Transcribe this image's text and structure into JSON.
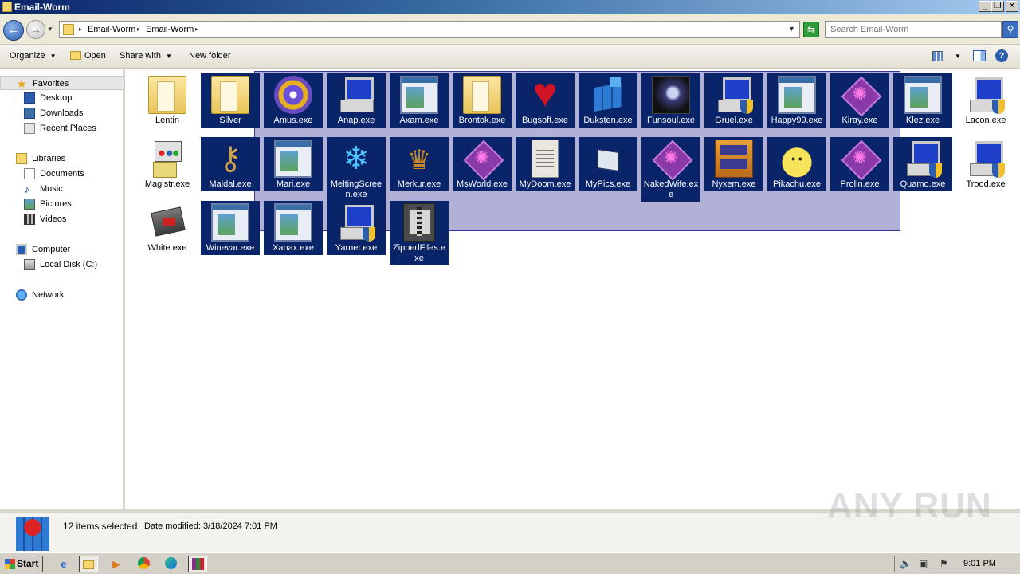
{
  "window": {
    "title": "Email-Worm"
  },
  "address": {
    "crumbs": [
      "Email-Worm",
      "Email-Worm"
    ],
    "search_placeholder": "Search Email-Worm"
  },
  "toolbar": {
    "organize": "Organize",
    "open": "Open",
    "share_with": "Share with",
    "new_folder": "New folder"
  },
  "sidebar": {
    "favorites": {
      "label": "Favorites",
      "items": [
        "Desktop",
        "Downloads",
        "Recent Places"
      ]
    },
    "libraries": {
      "label": "Libraries",
      "items": [
        "Documents",
        "Music",
        "Pictures",
        "Videos"
      ]
    },
    "computer": {
      "label": "Computer",
      "items": [
        "Local Disk (C:)"
      ]
    },
    "network": {
      "label": "Network"
    }
  },
  "files": [
    {
      "name": "Lentin",
      "selected": false,
      "icon": "folder-icon"
    },
    {
      "name": "Silver",
      "selected": true,
      "icon": "folder-icon"
    },
    {
      "name": "Amus.exe",
      "selected": true,
      "icon": "disc-icon"
    },
    {
      "name": "Anap.exe",
      "selected": true,
      "icon": "computer-icon"
    },
    {
      "name": "Axam.exe",
      "selected": true,
      "icon": "window-icon"
    },
    {
      "name": "Brontok.exe",
      "selected": true,
      "icon": "folder-icon"
    },
    {
      "name": "Bugsoft.exe",
      "selected": true,
      "icon": "heart-icon"
    },
    {
      "name": "Duksten.exe",
      "selected": true,
      "icon": "blocks-icon"
    },
    {
      "name": "Funsoul.exe",
      "selected": true,
      "icon": "vortex-icon"
    },
    {
      "name": "Gruel.exe",
      "selected": true,
      "icon": "computer-shield-icon"
    },
    {
      "name": "Happy99.exe",
      "selected": true,
      "icon": "window-icon"
    },
    {
      "name": "Kiray.exe",
      "selected": true,
      "icon": "gem-icon"
    },
    {
      "name": "Klez.exe",
      "selected": true,
      "icon": "window-icon"
    },
    {
      "name": "Lacon.exe",
      "selected": false,
      "icon": "computer-shield-icon"
    },
    {
      "name": "Magistr.exe",
      "selected": false,
      "icon": "installer-icon"
    },
    {
      "name": "Maldal.exe",
      "selected": true,
      "icon": "keys-icon"
    },
    {
      "name": "Mari.exe",
      "selected": true,
      "icon": "window-icon"
    },
    {
      "name": "MeltingScreen.exe",
      "selected": true,
      "icon": "snowflake-icon"
    },
    {
      "name": "Merkur.exe",
      "selected": true,
      "icon": "crown-icon"
    },
    {
      "name": "MsWorld.exe",
      "selected": true,
      "icon": "gem-icon"
    },
    {
      "name": "MyDoom.exe",
      "selected": true,
      "icon": "notepad-icon"
    },
    {
      "name": "MyPics.exe",
      "selected": true,
      "icon": "picture-icon"
    },
    {
      "name": "NakedWife.exe",
      "selected": true,
      "icon": "gem-icon"
    },
    {
      "name": "Nyxem.exe",
      "selected": true,
      "icon": "cabinet-icon"
    },
    {
      "name": "Pikachu.exe",
      "selected": true,
      "icon": "pikachu-icon"
    },
    {
      "name": "Prolin.exe",
      "selected": true,
      "icon": "gem-icon"
    },
    {
      "name": "Quamo.exe",
      "selected": true,
      "icon": "computer-shield-icon"
    },
    {
      "name": "Trood.exe",
      "selected": false,
      "icon": "computer-shield-icon"
    },
    {
      "name": "White.exe",
      "selected": false,
      "icon": "card-icon"
    },
    {
      "name": "Winevar.exe",
      "selected": true,
      "icon": "window-icon"
    },
    {
      "name": "Xanax.exe",
      "selected": true,
      "icon": "window-icon"
    },
    {
      "name": "Yarner.exe",
      "selected": true,
      "icon": "computer-shield-icon"
    },
    {
      "name": "ZippedFiles.exe",
      "selected": true,
      "icon": "zip-icon"
    }
  ],
  "details": {
    "selection": "12 items selected",
    "date_modified": "Date modified: 3/18/2024 7:01 PM"
  },
  "watermark": "ANY RUN",
  "taskbar": {
    "start": "Start",
    "clock": "9:01 PM"
  }
}
